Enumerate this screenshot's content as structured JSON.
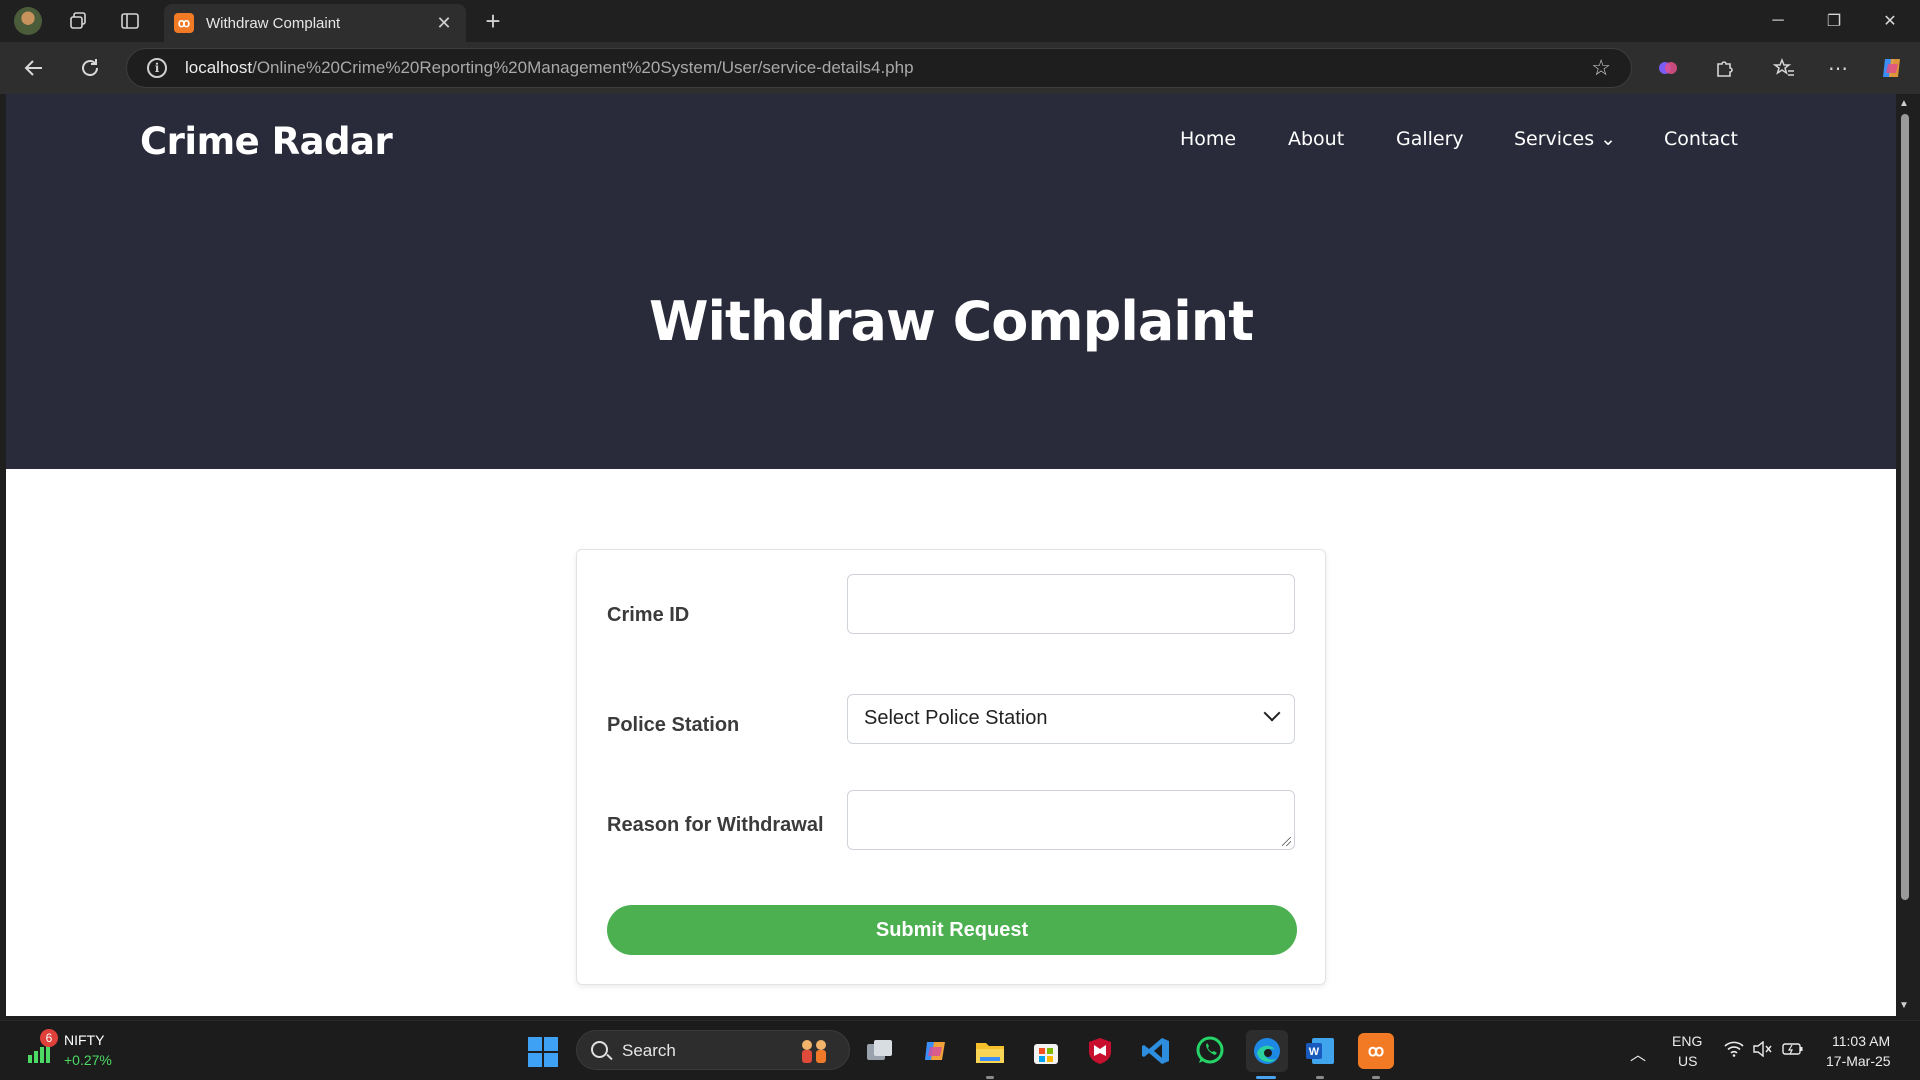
{
  "browser": {
    "tab_title": "Withdraw Complaint",
    "tab_close": "✕",
    "new_tab": "+",
    "url_host": "localhost",
    "url_path": "/Online%20Crime%20Reporting%20Management%20System/User/service-details4.php",
    "window_controls": {
      "minimize": "─",
      "restore": "❐",
      "close": "✕"
    }
  },
  "site": {
    "logo": "Crime Radar",
    "nav": [
      {
        "label": "Home"
      },
      {
        "label": "About"
      },
      {
        "label": "Gallery"
      },
      {
        "label": "Services ⌄"
      },
      {
        "label": "Contact"
      }
    ],
    "page_title": "Withdraw Complaint"
  },
  "form": {
    "crime_id_label": "Crime ID",
    "crime_id_value": "",
    "police_station_label": "Police Station",
    "police_station_selected": "Select Police Station",
    "reason_label": "Reason for Withdrawal",
    "reason_value": "",
    "submit_label": "Submit Request",
    "submit_color": "#4caf50"
  },
  "taskbar": {
    "nifty_badge": "6",
    "nifty_name": "NIFTY",
    "nifty_change": "+0.27%",
    "search_label": "Search",
    "lang_top": "ENG",
    "lang_bottom": "US",
    "time": "11:03 AM",
    "date": "17-Mar-25"
  },
  "colors": {
    "hero_bg": "#292b3a",
    "accent_green": "#4caf50",
    "tab_favicon": "#f27a24"
  }
}
